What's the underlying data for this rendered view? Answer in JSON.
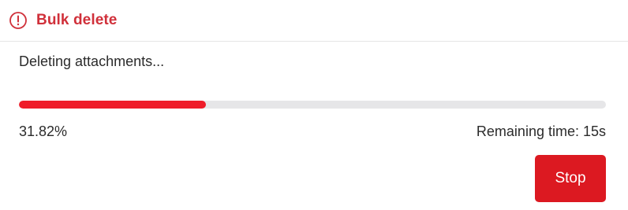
{
  "dialog": {
    "title": "Bulk delete",
    "title_icon": "warning-circle-icon",
    "status_text": "Deleting attachments...",
    "progress_percent": 31.82,
    "progress_label": "31.82%",
    "remaining_label": "Remaining time: 15s",
    "stop_label": "Stop"
  },
  "colors": {
    "accent_red": "#d0303a",
    "progress_fill": "#ef1c29",
    "progress_track": "#e6e6e8",
    "button_bg": "#dc1921"
  }
}
